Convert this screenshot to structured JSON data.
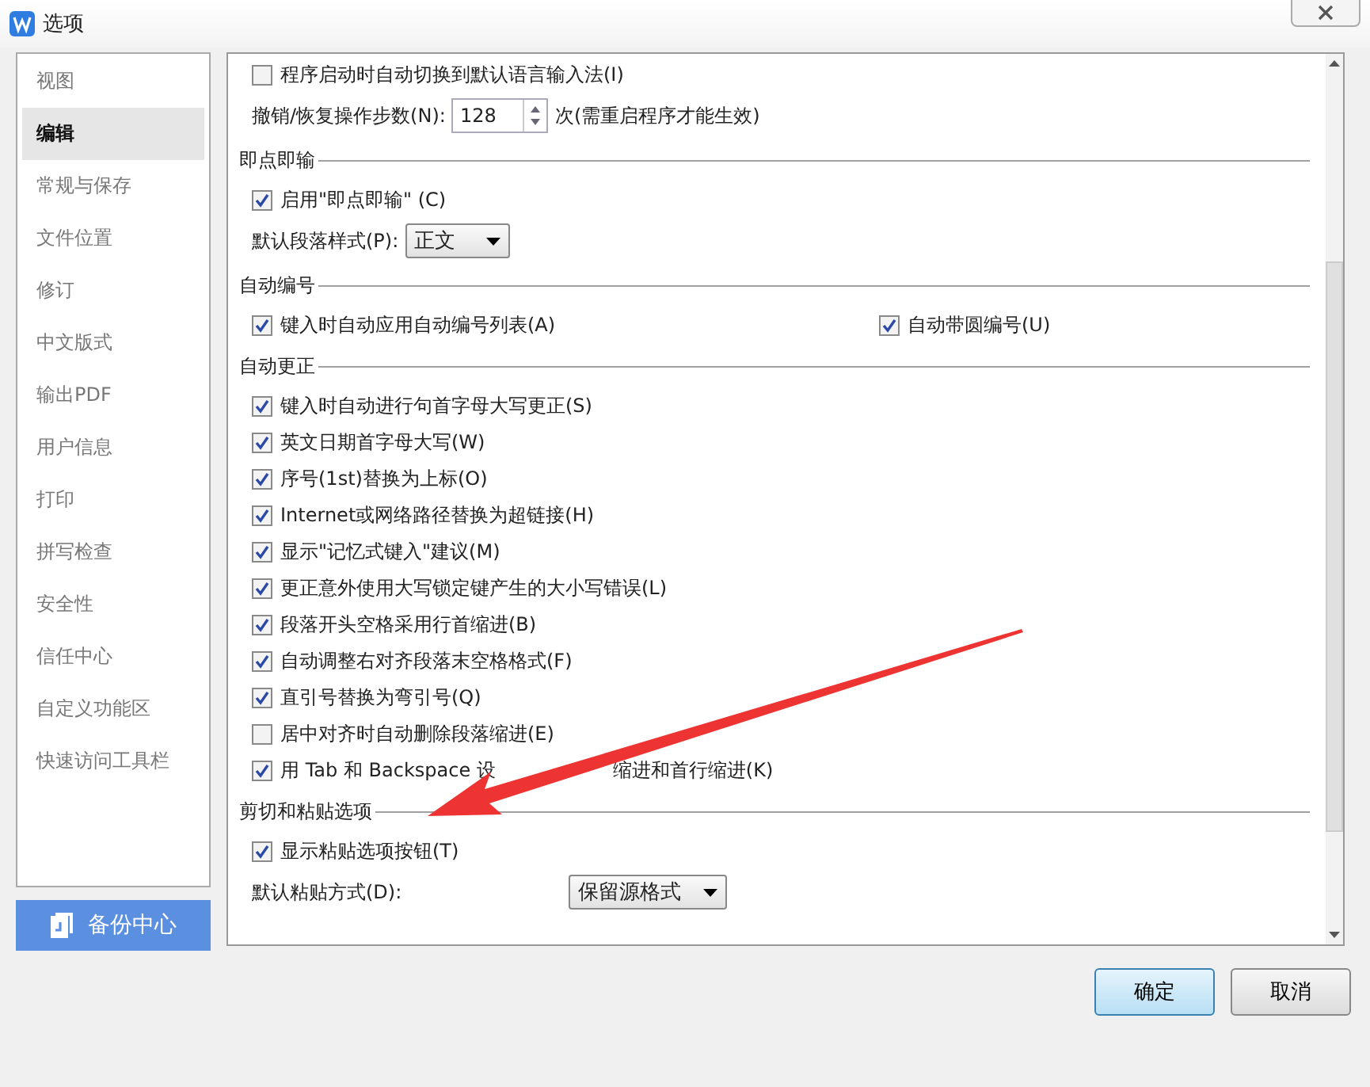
{
  "window": {
    "title": "选项"
  },
  "sidebar": {
    "items": [
      {
        "label": "视图",
        "selected": false
      },
      {
        "label": "编辑",
        "selected": true
      },
      {
        "label": "常规与保存",
        "selected": false
      },
      {
        "label": "文件位置",
        "selected": false
      },
      {
        "label": "修订",
        "selected": false
      },
      {
        "label": "中文版式",
        "selected": false
      },
      {
        "label": "输出PDF",
        "selected": false
      },
      {
        "label": "用户信息",
        "selected": false
      },
      {
        "label": "打印",
        "selected": false
      },
      {
        "label": "拼写检查",
        "selected": false
      },
      {
        "label": "安全性",
        "selected": false
      },
      {
        "label": "信任中心",
        "selected": false
      },
      {
        "label": "自定义功能区",
        "selected": false
      },
      {
        "label": "快速访问工具栏",
        "selected": false
      }
    ]
  },
  "backup_button": {
    "label": "备份中心"
  },
  "sections": [
    {
      "items": [
        {
          "kind": "checkbox",
          "label": "程序启动时自动切换到默认语言输入法(I)",
          "checked": false
        },
        {
          "kind": "spinner",
          "label": "撤销/恢复操作步数(N):",
          "value": "128",
          "note": "次(需重启程序才能生效)"
        }
      ]
    },
    {
      "title": "即点即输",
      "items": [
        {
          "kind": "checkbox",
          "label": "启用\"即点即输\" (C)",
          "checked": true
        },
        {
          "kind": "dropdown",
          "label": "默认段落样式(P):",
          "value": "正文"
        }
      ]
    },
    {
      "title": "自动编号",
      "items": [
        {
          "kind": "pair",
          "checkboxes": [
            {
              "label": "键入时自动应用自动编号列表(A)",
              "checked": true
            },
            {
              "label": "自动带圆编号(U)",
              "checked": true
            }
          ]
        }
      ]
    },
    {
      "title": "自动更正",
      "items": [
        {
          "kind": "checkbox",
          "label": "键入时自动进行句首字母大写更正(S)",
          "checked": true
        },
        {
          "kind": "checkbox",
          "label": "英文日期首字母大写(W)",
          "checked": true
        },
        {
          "kind": "checkbox",
          "label": "序号(1st)替换为上标(O)",
          "checked": true
        },
        {
          "kind": "checkbox",
          "label": "Internet或网络路径替换为超链接(H)",
          "checked": true
        },
        {
          "kind": "checkbox",
          "label": "显示\"记忆式键入\"建议(M)",
          "checked": true
        },
        {
          "kind": "checkbox",
          "label": "更正意外使用大写锁定键产生的大小写错误(L)",
          "checked": true
        },
        {
          "kind": "checkbox",
          "label": "段落开头空格采用行首缩进(B)",
          "checked": true
        },
        {
          "kind": "checkbox",
          "label": "自动调整右对齐段落末空格格式(F)",
          "checked": true
        },
        {
          "kind": "checkbox",
          "label": "直引号替换为弯引号(Q)",
          "checked": true
        },
        {
          "kind": "checkbox",
          "label": "居中对齐时自动删除段落缩进(E)",
          "checked": false
        },
        {
          "kind": "checkbox",
          "label": "用 Tab 和 Backspace 设",
          "label_rest": "缩进和首行缩进(K)",
          "arrow": true,
          "checked": true
        }
      ]
    },
    {
      "title": "剪切和粘贴选项",
      "items": [
        {
          "kind": "checkbox",
          "label": "显示粘贴选项按钮(T)",
          "checked": true
        },
        {
          "kind": "dropdown",
          "label": "默认粘贴方式(D):",
          "value": "保留源格式",
          "wide": true
        }
      ]
    }
  ],
  "buttons": [
    {
      "label": "确定",
      "kind": "primary"
    },
    {
      "label": "取消",
      "kind": "normal"
    }
  ]
}
